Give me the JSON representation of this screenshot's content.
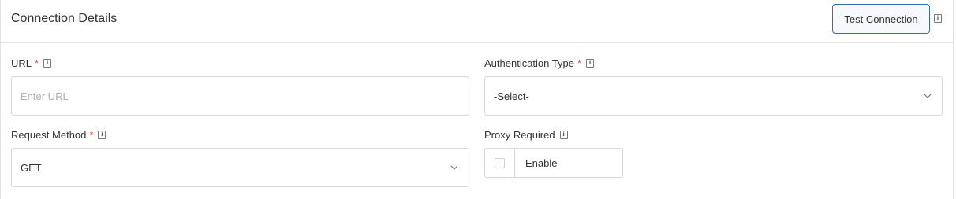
{
  "header": {
    "title": "Connection Details",
    "test_button_label": "Test Connection",
    "info_icon_glyph": "i"
  },
  "fields": {
    "url": {
      "label": "URL",
      "required_mark": "*",
      "placeholder": "Enter URL",
      "value": ""
    },
    "auth_type": {
      "label": "Authentication Type",
      "required_mark": "*",
      "selected": "-Select-"
    },
    "request_method": {
      "label": "Request Method",
      "required_mark": "*",
      "selected": "GET"
    },
    "proxy": {
      "label": "Proxy Required",
      "checkbox_label": "Enable",
      "checked": false
    }
  },
  "colors": {
    "accent": "#2f6fb5",
    "required": "#e04848",
    "border": "#d7d7d7",
    "placeholder": "#b0b0b0"
  }
}
